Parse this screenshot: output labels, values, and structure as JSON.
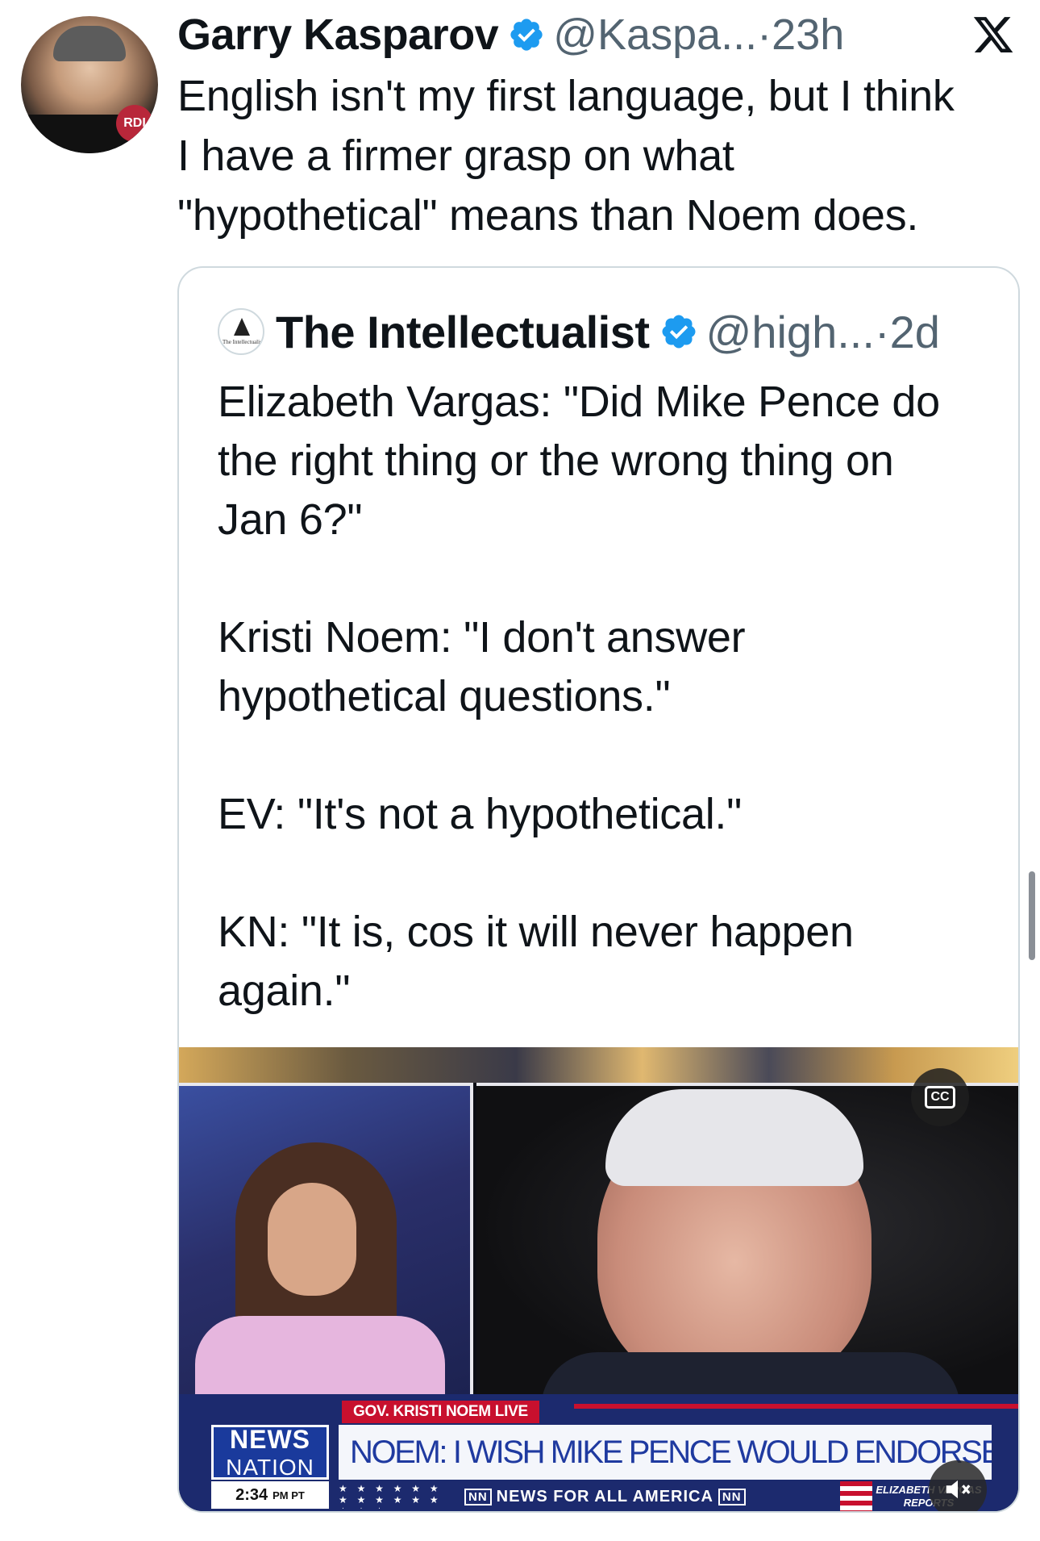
{
  "tweet": {
    "author_name": "Garry Kasparov",
    "author_handle": "@Kaspa...",
    "time": "23h",
    "separator": "·",
    "avatar_badge": "RDI",
    "text": "English isn't my first language, but I think\nI have a firmer grasp on what\n\"hypothetical\" means than Noem does."
  },
  "quoted_tweet": {
    "author_name": "The Intellectualist",
    "author_handle": "@high...",
    "time": "2d",
    "separator": "·",
    "avatar_text": "The Intellectualist",
    "text": "Elizabeth Vargas: \"Did Mike Pence do\nthe right thing or the wrong thing on\nJan 6?\"\n\nKristi Noem: \"I don't answer\nhypothetical questions.\"\n\nEV: \"It's not a hypothetical.\"\n\nKN: \"It is, cos it will never happen\nagain.\""
  },
  "video": {
    "tag": "GOV. KRISTI NOEM LIVE",
    "headline": "NOEM: I WISH MIKE PENCE WOULD ENDORSE TRUMP",
    "logo_line1": "NEWS",
    "logo_line2": "NATION",
    "time": "2:34",
    "time_zone": "PM PT",
    "ticker_prefix": "NN",
    "ticker_text": "NEWS FOR ALL AMERICA",
    "ticker_suffix": "NN",
    "brand": "ELIZABETH VARGAS REPORTS",
    "cc_label": "CC"
  },
  "icons": {
    "verified": "verified-badge-icon",
    "x_logo": "x-logo-icon",
    "captions": "closed-captions-icon",
    "mute": "muted-speaker-icon"
  },
  "colors": {
    "verified_blue": "#1d9bf0",
    "text_primary": "#0f1419",
    "text_secondary": "#536471",
    "border": "#cfd9de",
    "news_red": "#c8102e",
    "news_blue": "#1c2a6e"
  }
}
